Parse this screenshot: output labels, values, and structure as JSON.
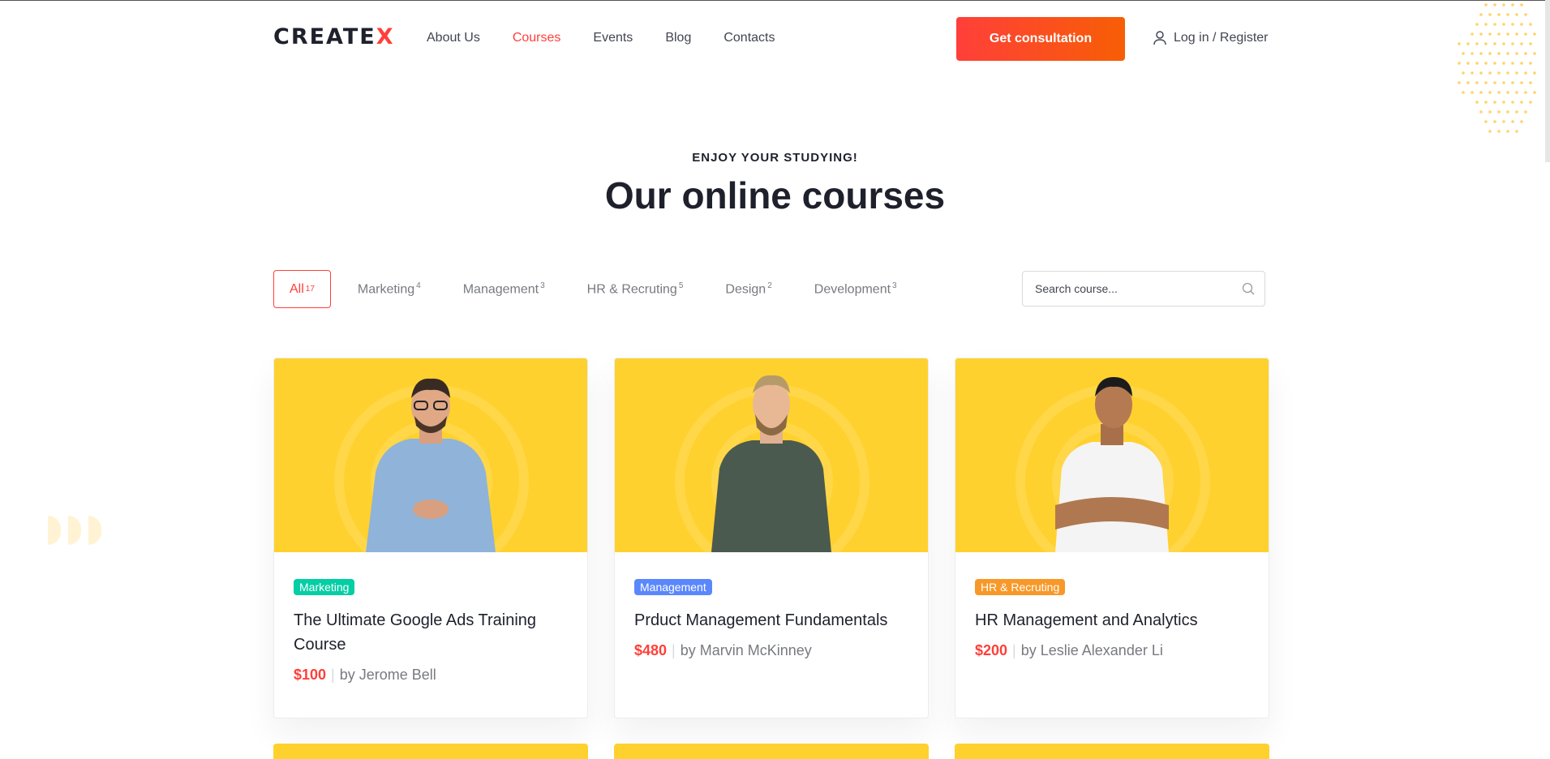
{
  "header": {
    "logo_text": "CREATE",
    "logo_x": "X",
    "nav": [
      "About Us",
      "Courses",
      "Events",
      "Blog",
      "Contacts"
    ],
    "active_nav": "Courses",
    "cta_label": "Get consultation",
    "login_label": "Log in / Register"
  },
  "hero": {
    "eyebrow": "ENJOY YOUR STUDYING!",
    "title": "Our online courses"
  },
  "filters": [
    {
      "label": "All",
      "count": "17"
    },
    {
      "label": "Marketing",
      "count": "4"
    },
    {
      "label": "Management",
      "count": "3"
    },
    {
      "label": "HR & Recruting",
      "count": "5"
    },
    {
      "label": "Design",
      "count": "2"
    },
    {
      "label": "Development",
      "count": "3"
    }
  ],
  "search": {
    "placeholder": "Search course..."
  },
  "courses": [
    {
      "category": "Marketing",
      "category_color": "#03cea4",
      "title": "The Ultimate Google Ads Training Course",
      "price": "$100",
      "author": "by Jerome Bell",
      "shirt_color": "#8fb3d9"
    },
    {
      "category": "Management",
      "category_color": "#5a87fc",
      "title": "Prduct Management Fundamentals",
      "price": "$480",
      "author": "by Marvin McKinney",
      "shirt_color": "#4b5a4f"
    },
    {
      "category": "HR & Recruting",
      "category_color": "#f89828",
      "title": "HR Management and Analytics",
      "price": "$200",
      "author": "by Leslie Alexander Li",
      "shirt_color": "#f4f4f4"
    }
  ],
  "colors": {
    "accent": "#ff3f3a",
    "card_bg": "#ffd12e",
    "text": "#1e212c",
    "muted": "#787a80"
  }
}
